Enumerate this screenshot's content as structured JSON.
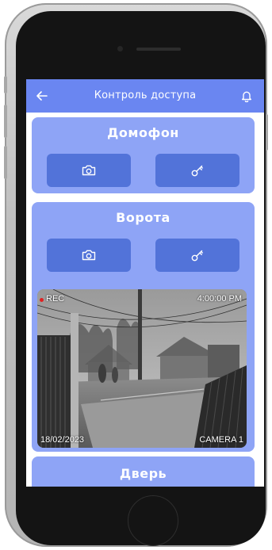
{
  "header": {
    "title": "Контроль доступа",
    "back_icon": "arrow-left-icon",
    "bell_icon": "bell-icon"
  },
  "cards": {
    "intercom": {
      "title": "Домофон",
      "buttons": [
        {
          "icon": "camera-icon"
        },
        {
          "icon": "key-icon"
        }
      ]
    },
    "gate": {
      "title": "Ворота",
      "buttons": [
        {
          "icon": "camera-icon"
        },
        {
          "icon": "key-icon"
        }
      ],
      "camera": {
        "rec_label": "REC",
        "time": "4:00:00 PM",
        "date": "18/02/2023",
        "camera_name": "CAMERA 1"
      }
    },
    "door": {
      "title": "Дверь"
    }
  },
  "colors": {
    "header": "#6a86f1",
    "card": "#8ea4f6",
    "button": "#5273d9",
    "rec": "#e02020"
  }
}
